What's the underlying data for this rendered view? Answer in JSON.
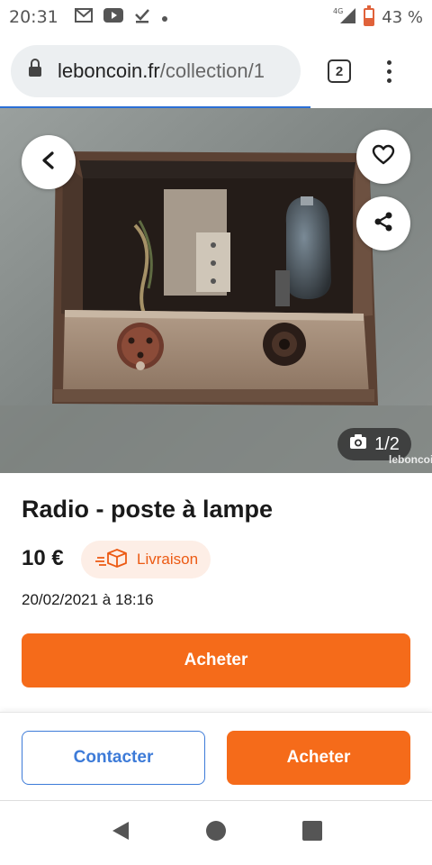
{
  "status_bar": {
    "time": "20:31",
    "network": "4G",
    "battery": "43 %"
  },
  "browser": {
    "url_domain": "leboncoin.fr",
    "url_path": "/collection/1",
    "tab_count": "2"
  },
  "hero": {
    "photo_counter": "1/2",
    "watermark": "leboncoin"
  },
  "listing": {
    "title": "Radio - poste à lampe",
    "price": "10 €",
    "delivery_label": "Livraison",
    "date": "20/02/2021 à 18:16",
    "buy_label": "Acheter"
  },
  "footer": {
    "contact_label": "Contacter",
    "buy_label": "Acheter"
  },
  "colors": {
    "accent": "#f56b1a",
    "contact_blue": "#3d7bd8",
    "delivery_bg": "#fdeee6"
  }
}
